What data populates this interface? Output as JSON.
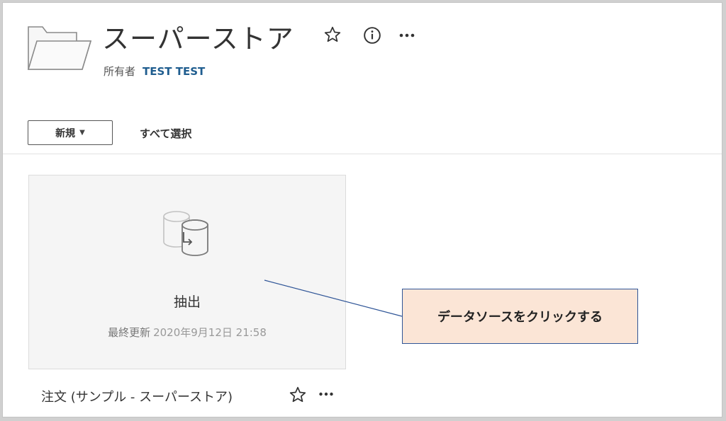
{
  "header": {
    "title": "スーパーストア",
    "owner_label": "所有者",
    "owner_name": "TEST TEST"
  },
  "toolbar": {
    "new_label": "新規",
    "select_all_label": "すべて選択"
  },
  "card": {
    "type_label": "抽出",
    "updated_label": "最終更新",
    "updated_value": "2020年9月12日 21:58"
  },
  "datasource": {
    "name": "注文 (サンプル - スーパーストア)"
  },
  "annotation": {
    "text": "データソースをクリックする"
  },
  "icons": [
    "folder-icon",
    "star-icon",
    "info-icon",
    "more-icon",
    "database-extract-icon"
  ],
  "colors": {
    "owner_link": "#1f5d8f",
    "callout_fill": "#fbe5d6",
    "callout_border": "#2f5597"
  }
}
